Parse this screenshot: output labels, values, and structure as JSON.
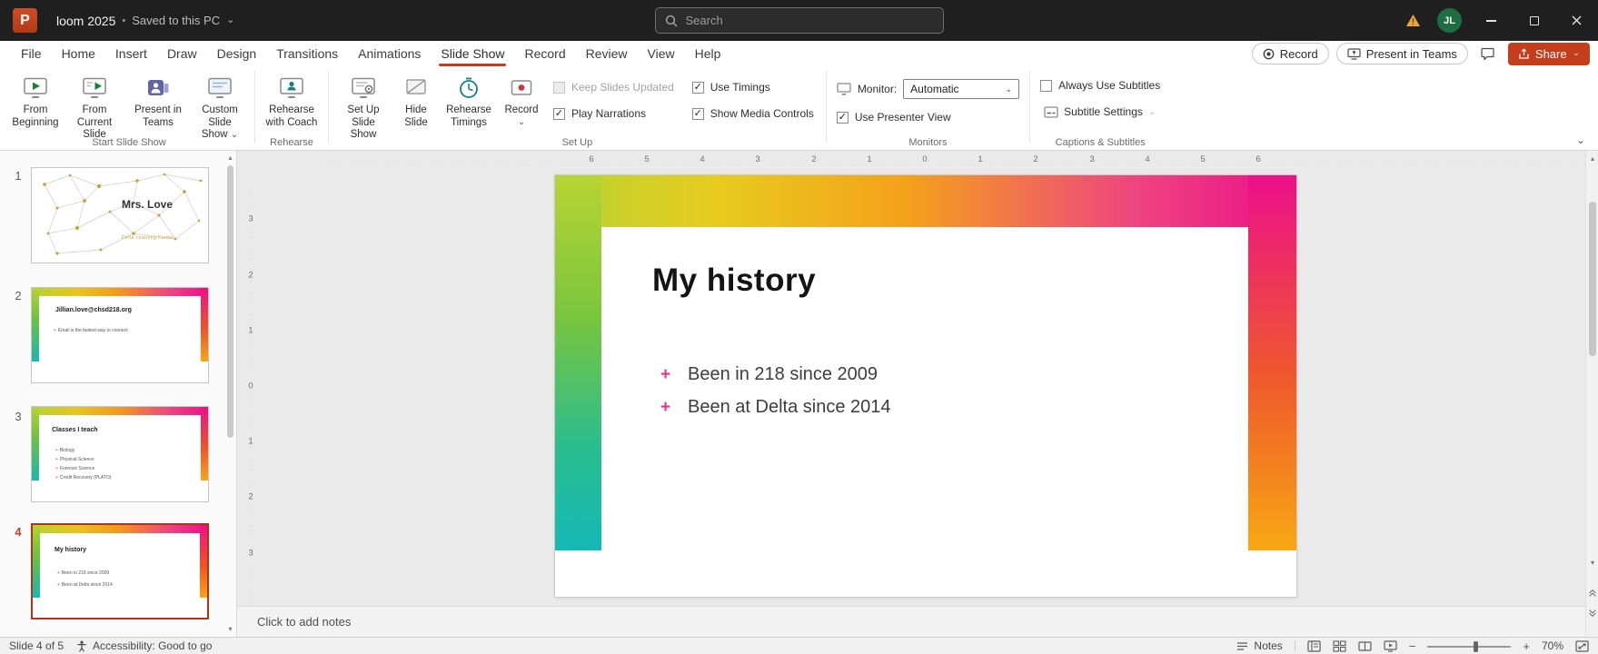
{
  "titlebar": {
    "app_initial": "P",
    "title": "loom 2025",
    "separator": "•",
    "saved_status": "Saved to this PC",
    "search_placeholder": "Search",
    "avatar_initials": "JL"
  },
  "glyphs": {
    "chevron_down": "⌄",
    "up": "▴",
    "down": "▾",
    "minus": "−",
    "plus": "+"
  },
  "menubar": {
    "tabs": [
      "File",
      "Home",
      "Insert",
      "Draw",
      "Design",
      "Transitions",
      "Animations",
      "Slide Show",
      "Record",
      "Review",
      "View",
      "Help"
    ],
    "active_tab": "Slide Show",
    "record_label": "Record",
    "present_label": "Present in Teams",
    "share_label": "Share"
  },
  "ribbon": {
    "buttons": {
      "from_beginning": "From Beginning",
      "from_current": "From Current Slide",
      "present_teams": "Present in Teams",
      "custom_show": "Custom Slide Show",
      "rehearse_coach": "Rehearse with Coach",
      "setup_show": "Set Up Slide Show",
      "hide_slide": "Hide Slide",
      "rehearse_timings": "Rehearse Timings",
      "record": "Record"
    },
    "checkboxes": {
      "keep_slides_updated": {
        "label": "Keep Slides Updated",
        "mark": ""
      },
      "play_narrations": {
        "label": "Play Narrations",
        "mark": "✓"
      },
      "use_timings": {
        "label": "Use Timings",
        "mark": "✓"
      },
      "show_media_controls": {
        "label": "Show Media Controls",
        "mark": "✓"
      },
      "use_presenter_view": {
        "label": "Use Presenter View",
        "mark": "✓"
      },
      "always_use_subtitles": {
        "label": "Always Use Subtitles",
        "mark": ""
      }
    },
    "monitor_label": "Monitor:",
    "monitor_value": "Automatic",
    "subtitle_settings": "Subtitle Settings",
    "group_labels": [
      "Start Slide Show",
      "Rehearse",
      "Set Up",
      "Monitors",
      "Captions & Subtitles"
    ]
  },
  "thumbnails": {
    "slides": [
      {
        "number": "1",
        "title": "Mrs. Love",
        "subtitle": "Delta Learning Center"
      },
      {
        "number": "2",
        "title": "Jillian.love@chsd218.org",
        "bullets": [
          "Email is the fastest way to connect"
        ]
      },
      {
        "number": "3",
        "title": "Classes I teach",
        "bullets": [
          "Biology",
          "Physical Science",
          "Forensic Science",
          "Credit Recovery (PLATO)"
        ]
      },
      {
        "number": "4",
        "title": "My history",
        "bullets": [
          "Been in 218 since 2009",
          "Been at Delta since 2014"
        ]
      }
    ]
  },
  "ruler": {
    "h": [
      "6",
      "5",
      "4",
      "3",
      "2",
      "1",
      "0",
      "1",
      "2",
      "3",
      "4",
      "5",
      "6"
    ],
    "v": [
      "3",
      "2",
      "1",
      "0",
      "1",
      "2",
      "3"
    ]
  },
  "slide": {
    "title": "My history",
    "bullet_marker": "+",
    "bullets": [
      "Been in 218 since 2009",
      "Been at Delta since 2014"
    ]
  },
  "notes": {
    "placeholder": "Click to add notes"
  },
  "statusbar": {
    "slide_indicator": "Slide 4 of 5",
    "accessibility": "Accessibility: Good to go",
    "notes_label": "Notes",
    "zoom_level": "70%"
  },
  "colors": {
    "accent": "#c43e1c",
    "magenta": "#ec0f8a",
    "teal": "#14b8b6",
    "yellow_green": "#b8d433",
    "orange": "#f8a814"
  }
}
